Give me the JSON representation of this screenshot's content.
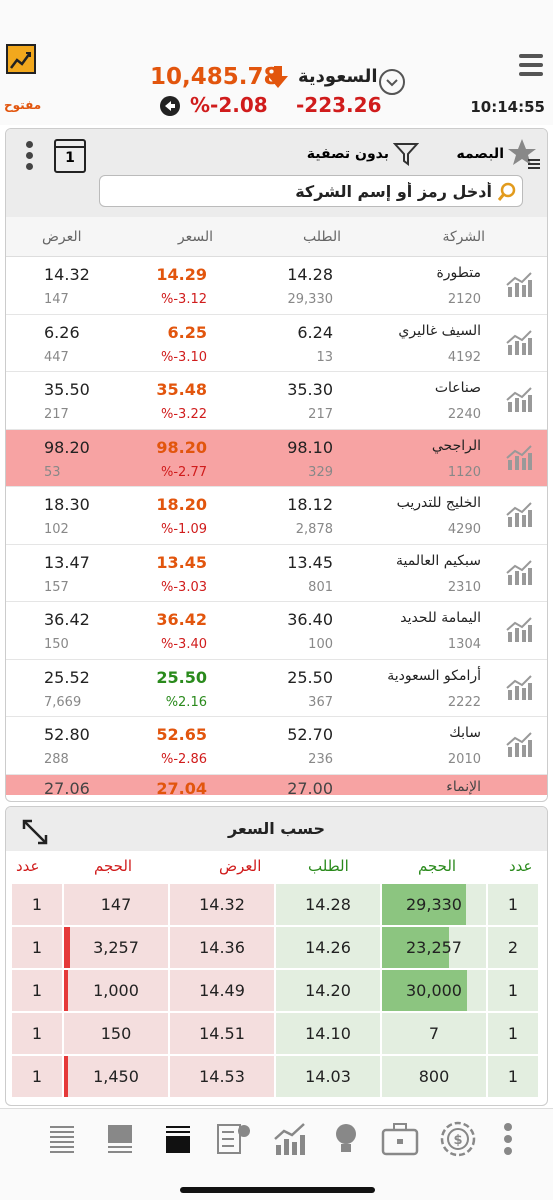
{
  "header": {
    "market_status": "مفتوح",
    "index_value": "10,485.78",
    "market_name": "السعودية",
    "change_pct": "%-2.08",
    "change_value": "-223.26",
    "time": "10:14:55"
  },
  "toolbar": {
    "favorite_label": "البصمه",
    "filter_label": "بدون تصفية",
    "calendar_day": "1",
    "search_placeholder": "أدخل رمز أو إسم الشركة"
  },
  "columns": {
    "company": "الشركة",
    "bid": "الطلب",
    "price": "السعر",
    "ask": "العرض"
  },
  "stocks": [
    {
      "name": "متطورة",
      "code": "2120",
      "bid": "14.28",
      "volume": "29,330",
      "price": "14.29",
      "pct": "%-3.12",
      "ask": "14.32",
      "trades": "147"
    },
    {
      "name": "السيف غاليري",
      "code": "4192",
      "bid": "6.24",
      "volume": "13",
      "price": "6.25",
      "pct": "%-3.10",
      "ask": "6.26",
      "trades": "447"
    },
    {
      "name": "صناعات",
      "code": "2240",
      "bid": "35.30",
      "volume": "217",
      "price": "35.48",
      "pct": "%-3.22",
      "ask": "35.50",
      "trades": "217"
    },
    {
      "name": "الراجحي",
      "code": "1120",
      "bid": "98.10",
      "volume": "329",
      "price": "98.20",
      "pct": "%-2.77",
      "ask": "98.20",
      "trades": "53"
    },
    {
      "name": "الخليج للتدريب",
      "code": "4290",
      "bid": "18.12",
      "volume": "2,878",
      "price": "18.20",
      "pct": "%-1.09",
      "ask": "18.30",
      "trades": "102"
    },
    {
      "name": "سبكيم العالمية",
      "code": "2310",
      "bid": "13.45",
      "volume": "801",
      "price": "13.45",
      "pct": "%-3.03",
      "ask": "13.47",
      "trades": "157"
    },
    {
      "name": "اليمامة للحديد",
      "code": "1304",
      "bid": "36.40",
      "volume": "100",
      "price": "36.42",
      "pct": "%-3.40",
      "ask": "36.42",
      "trades": "150"
    },
    {
      "name": "أرامكو السعودية",
      "code": "2222",
      "bid": "25.50",
      "volume": "367",
      "price": "25.50",
      "pct": "%2.16",
      "ask": "25.52",
      "trades": "7,669"
    },
    {
      "name": "سابك",
      "code": "2010",
      "bid": "52.70",
      "volume": "236",
      "price": "52.65",
      "pct": "%-2.86",
      "ask": "52.80",
      "trades": "288"
    }
  ],
  "partial_row": {
    "name": "الإنماء",
    "bid": "27.00",
    "price": "27.04",
    "ask": "27.06"
  },
  "depth": {
    "title": "حسب السعر",
    "headers": {
      "sell_count": "عدد",
      "sell_volume": "الحجم",
      "ask": "العرض",
      "bid": "الطلب",
      "buy_volume": "الحجم",
      "buy_count": "عدد"
    },
    "levels": [
      {
        "sell_count": "1",
        "sell_volume": "147",
        "ask": "14.32",
        "bid": "14.28",
        "buy_volume": "29,330",
        "buy_count": "1",
        "sell_fill": 0.0,
        "buy_fill": 0.98
      },
      {
        "sell_count": "1",
        "sell_volume": "3,257",
        "ask": "14.36",
        "bid": "14.26",
        "buy_volume": "23,257",
        "buy_count": "2",
        "sell_fill": 0.1,
        "buy_fill": 0.78
      },
      {
        "sell_count": "1",
        "sell_volume": "1,000",
        "ask": "14.49",
        "bid": "14.20",
        "buy_volume": "30,000",
        "buy_count": "1",
        "sell_fill": 0.03,
        "buy_fill": 1.0
      },
      {
        "sell_count": "1",
        "sell_volume": "150",
        "ask": "14.51",
        "bid": "14.10",
        "buy_volume": "7",
        "buy_count": "1",
        "sell_fill": 0.0,
        "buy_fill": 0.0
      },
      {
        "sell_count": "1",
        "sell_volume": "1,450",
        "ask": "14.53",
        "bid": "14.03",
        "buy_volume": "800",
        "buy_count": "1",
        "sell_fill": 0.04,
        "buy_fill": 0.0
      }
    ]
  },
  "tabbar": {
    "icons": [
      "list-icon",
      "list-compact-icon",
      "depth-icon",
      "screener-icon",
      "chart-icon",
      "ideas-icon",
      "portfolio-icon",
      "currency-icon",
      "more-icon"
    ]
  },
  "colors": {
    "accent": "#e2550d",
    "down": "#d01c1c",
    "up": "#2a8a1c",
    "highlight": "#f7a3a3"
  }
}
